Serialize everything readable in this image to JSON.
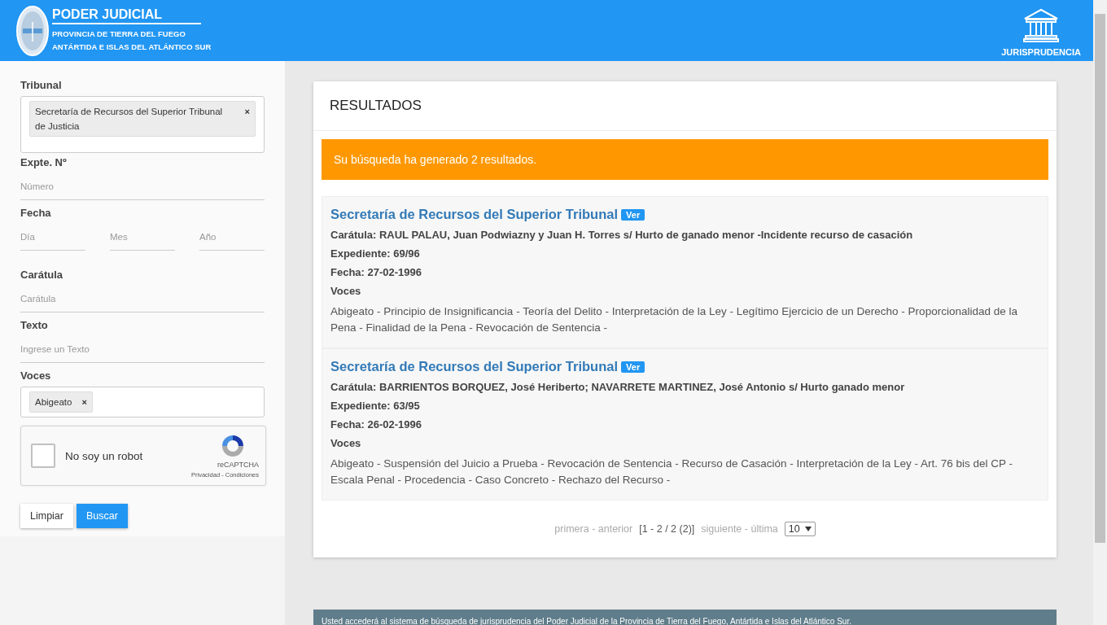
{
  "header": {
    "title": "PODER JUDICIAL",
    "subtitle_1": "PROVINCIA DE TIERRA DEL FUEGO",
    "subtitle_2": "ANTÁRTIDA E ISLAS DEL ATLÁNTICO SUR",
    "section": "JURISPRUDENCIA"
  },
  "filters": {
    "tribunal": {
      "label": "Tribunal",
      "tags": [
        {
          "label": "Secretaría de Recursos del Superior Tribunal de Justicia",
          "remove": "×"
        }
      ]
    },
    "expediente": {
      "label": "Expte. Nº",
      "placeholder": "Número"
    },
    "fecha": {
      "label": "Fecha",
      "fields": [
        {
          "placeholder": "Día"
        },
        {
          "placeholder": "Mes"
        },
        {
          "placeholder": "Año"
        }
      ]
    },
    "caratula": {
      "label": "Carátula",
      "placeholder": "Carátula"
    },
    "texto": {
      "label": "Texto",
      "placeholder": "Ingrese un Texto"
    },
    "voces": {
      "label": "Voces",
      "tags": [
        {
          "label": "Abigeato",
          "remove": "×"
        }
      ]
    },
    "captcha": {
      "checked": false,
      "label": "No soy un robot",
      "brand": "reCAPTCHA",
      "links": "Privacidad - Condiciones"
    },
    "buttons": [
      {
        "label": "Limpiar",
        "kind": "secondary"
      },
      {
        "label": "Buscar",
        "kind": "primary"
      }
    ]
  },
  "results": {
    "title": "RESULTADOS",
    "alert": "Su búsqueda ha generado 2 resultados.",
    "items": [
      {
        "tribunal": "Secretaría de Recursos del Superior Tribunal",
        "badge": "Ver",
        "caratula": "Carátula: RAUL PALAU, Juan Podwiazny y Juan H. Torres s/ Hurto de ganado menor -Incidente recurso de casación",
        "expediente": "Expediente: 69/96",
        "fecha": "Fecha: 27-02-1996",
        "voces_label": "Voces",
        "voces": "Abigeato - Principio de Insignificancia - Teoría del Delito - Interpretación de la Ley - Legítimo Ejercicio de un Derecho - Proporcionalidad de la Pena - Finalidad de la Pena - Revocación de Sentencia -"
      },
      {
        "tribunal": "Secretaría de Recursos del Superior Tribunal",
        "badge": "Ver",
        "caratula": "Carátula: BARRIENTOS BORQUEZ, José Heriberto; NAVARRETE MARTINEZ, José Antonio s/ Hurto ganado menor",
        "expediente": "Expediente: 63/95",
        "fecha": "Fecha: 26-02-1996",
        "voces_label": "Voces",
        "voces": "Abigeato - Suspensión del Juicio a Prueba - Revocación de Sentencia - Recurso de Casación - Interpretación de la Ley - Art. 76 bis del CP - Escala Penal - Procedencia - Caso Concreto - Rechazo del Recurso -"
      }
    ],
    "pagination": {
      "first_prev": "primera - anterior",
      "range": "[1 - 2 / 2 (2)]",
      "next_last": "siguiente - última",
      "page_size": "10"
    }
  },
  "footer": {
    "text": "Usted accederá al sistema de búsqueda de jurisprudencia del Poder Judicial de la Provincia de Tierra del Fuego, Antártida e Islas del Atlántico Sur."
  }
}
